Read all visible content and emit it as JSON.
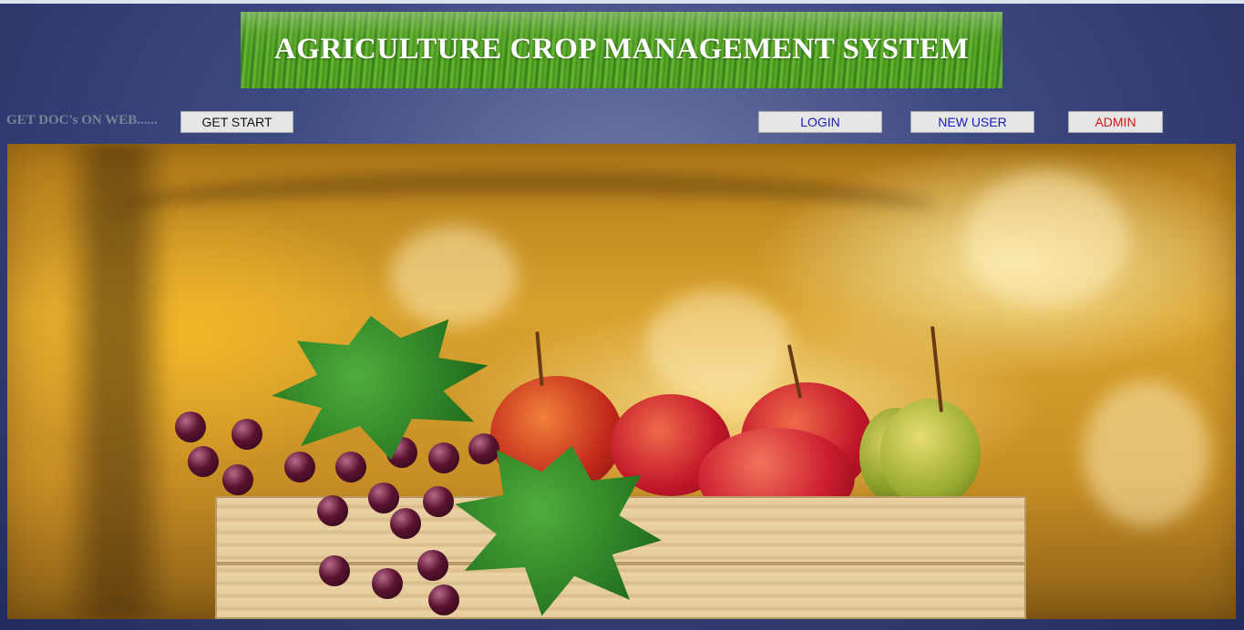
{
  "header": {
    "title": "AGRICULTURE CROP MANAGEMENT SYSTEM"
  },
  "toolbar": {
    "docs_label": "GET DOC's ON WEB......",
    "get_start_label": "GET START",
    "login_label": "LOGIN",
    "new_user_label": "NEW USER",
    "admin_label": "ADMIN"
  },
  "colors": {
    "background": "#3e4a82",
    "link_blue": "#1a1ab8",
    "admin_red": "#d41414"
  }
}
